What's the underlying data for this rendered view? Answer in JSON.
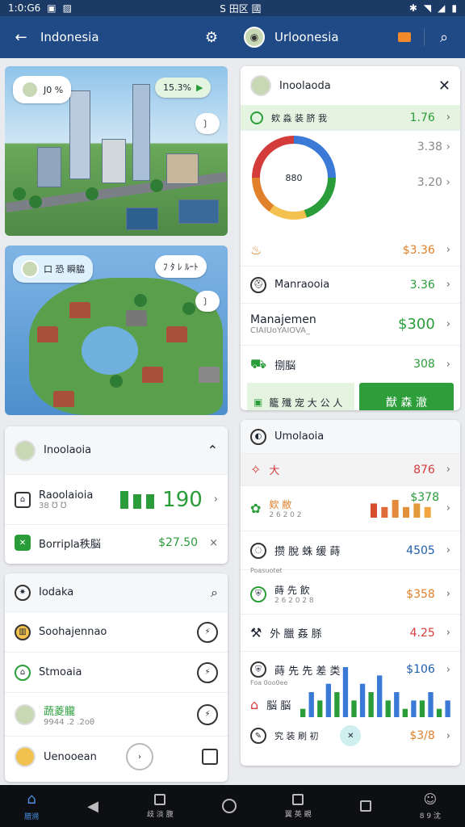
{
  "status": {
    "time": "1:0:G6",
    "icons_text": "S 田区 國",
    "accent": "#1b3a66"
  },
  "left_appbar": {
    "title": "Indonesia"
  },
  "right_appbar": {
    "title": "Urloonesia"
  },
  "city_card": {
    "badge": "J0 %",
    "pct": "15.3%"
  },
  "island_card": {
    "title": "口 恐 瞬脇",
    "tag": "ﾌ ﾀ ﾚ ﾙｰﾄ"
  },
  "summary": {
    "title": "Inoolaoia",
    "row1_label": "Raoolaioia",
    "row1_sub": "38 ℧ ℧",
    "row1_value": "190",
    "row2_label": "Borripla秩脳",
    "row2_value": "$27.50"
  },
  "list": {
    "title": "Iodaka",
    "items": [
      "Soohajennao",
      "Stmoaia",
      "蔬菱朧",
      "Uenooean"
    ],
    "item3_sub": "9944 .2 .2oθ"
  },
  "detail": {
    "title": "Inoolaoda",
    "r1_label": "欸 淼 装 脐 我",
    "r1_value": "1.76",
    "r2_value": "3.38",
    "r3_value": "3.20",
    "gauge_value": "880",
    "r4_value": "$3.36",
    "r5_label": "Manraooia",
    "r5_value": "3.36",
    "r6_label": "Manajemen",
    "r6_sub": "CIAIUoYAIOVA_",
    "r6_value": "$300",
    "r7_label": "捌脳",
    "r7_value": "308",
    "btn1": "籠 殲 宠 大 公 人",
    "btn2": "猷 森 澈"
  },
  "right_list": {
    "title": "Umolaoia",
    "rows": [
      {
        "label": "大",
        "value": "876"
      },
      {
        "label": "欸 敝",
        "sub": "2 6 2 0 2",
        "value": "$378"
      },
      {
        "label": "攒 脫 蛛 缓 蒔",
        "value": "4505"
      },
      {
        "label": "蒔 先 飲",
        "sub": "2 6 2 0 2 8",
        "value": "$358"
      },
      {
        "label": "外 臘 姦 脎",
        "value": "4.25"
      },
      {
        "label": "蒔 先 先 差 类",
        "value": "$106"
      },
      {
        "label": "脳 脳",
        "value": ""
      },
      {
        "label": "究 装 刷 初",
        "value": "$3/8"
      }
    ],
    "small_label": "Poasuotet",
    "small_label2": "Foa 0oo0ee"
  },
  "navbar": {
    "items": [
      "腊溯",
      "",
      "歧 淡 腹",
      "",
      "翼 英 覡",
      "",
      "8 9 沈"
    ]
  },
  "chart_data": [
    {
      "type": "bar",
      "title": "",
      "values": [
        4,
        3,
        5,
        3,
        4,
        3
      ],
      "colors": [
        "#d44d2d",
        "#e06b3a",
        "#e38b3a",
        "#e3903a",
        "#e39a3a",
        "#f0a540"
      ]
    },
    {
      "type": "bar",
      "title": "",
      "values": [
        1,
        3,
        2,
        4,
        3,
        6,
        2,
        4,
        3,
        5,
        2,
        3,
        1,
        2,
        2,
        3,
        1,
        2
      ],
      "colors": [
        "#2a9d3a",
        "#3a7ad6"
      ]
    }
  ]
}
